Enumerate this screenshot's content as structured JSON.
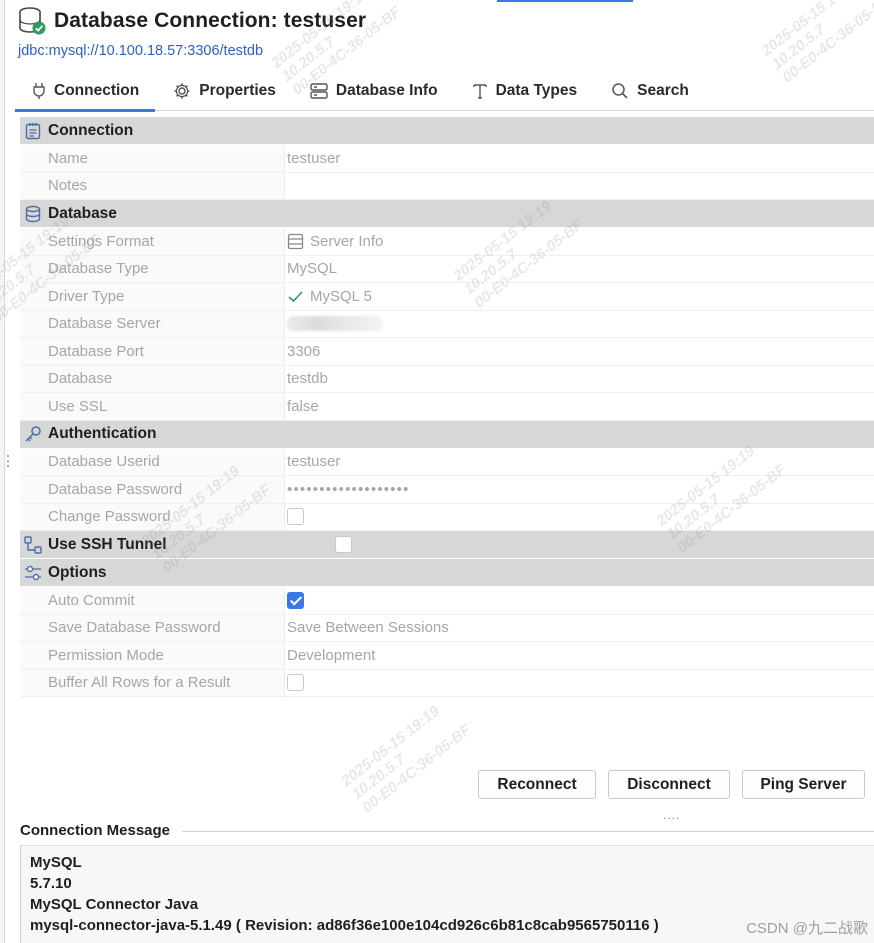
{
  "header": {
    "title": "Database Connection: testuser",
    "jdbc_url": "jdbc:mysql://10.100.18.57:3306/testdb"
  },
  "tabs": [
    {
      "label": "Connection",
      "icon": "plug-icon",
      "active": true
    },
    {
      "label": "Properties",
      "icon": "gear-icon",
      "active": false
    },
    {
      "label": "Database Info",
      "icon": "server-icon",
      "active": false
    },
    {
      "label": "Data Types",
      "icon": "text-type-icon",
      "active": false
    },
    {
      "label": "Search",
      "icon": "search-icon",
      "active": false
    }
  ],
  "sections": {
    "connection": {
      "label": "Connection",
      "name_key": "Name",
      "name_value": "testuser",
      "notes_key": "Notes",
      "notes_value": ""
    },
    "database": {
      "label": "Database",
      "settings_format_key": "Settings Format",
      "settings_format_value": "Server Info",
      "database_type_key": "Database Type",
      "database_type_value": "MySQL",
      "driver_type_key": "Driver Type",
      "driver_type_value": "MySQL 5",
      "database_server_key": "Database Server",
      "database_port_key": "Database Port",
      "database_port_value": "3306",
      "database_key": "Database",
      "database_value": "testdb",
      "use_ssl_key": "Use SSL",
      "use_ssl_value": "false"
    },
    "authentication": {
      "label": "Authentication",
      "userid_key": "Database Userid",
      "userid_value": "testuser",
      "password_key": "Database Password",
      "password_value": "•••••••••••••••••••",
      "change_password_key": "Change Password",
      "change_password_checked": false
    },
    "ssh": {
      "label": "Use SSH Tunnel",
      "checked": false
    },
    "options": {
      "label": "Options",
      "auto_commit_key": "Auto Commit",
      "auto_commit_checked": true,
      "save_password_key": "Save Database Password",
      "save_password_value": "Save Between Sessions",
      "permission_mode_key": "Permission Mode",
      "permission_mode_value": "Development",
      "buffer_rows_key": "Buffer All Rows for a Result",
      "buffer_rows_checked": false
    }
  },
  "actions": {
    "reconnect": "Reconnect",
    "disconnect": "Disconnect",
    "ping_server": "Ping Server"
  },
  "splitter_grip": "....",
  "connection_message": {
    "legend": "Connection Message",
    "lines": [
      "MySQL",
      "5.7.10",
      "MySQL Connector Java",
      "mysql-connector-java-5.1.49 ( Revision: ad86f36e100e104cd926c6b81c8cab9565750116 )"
    ]
  },
  "watermark": {
    "text": "2025-05-15 19:19\n10.20.5.7\n00-E0-4C-36-05-BF",
    "csdn": "CSDN @九二战歌"
  },
  "colors": {
    "accent": "#3b78e7",
    "section_bg": "#d7d7d7",
    "muted_text": "#a6a6a6",
    "check_green": "#2e9b5f"
  }
}
